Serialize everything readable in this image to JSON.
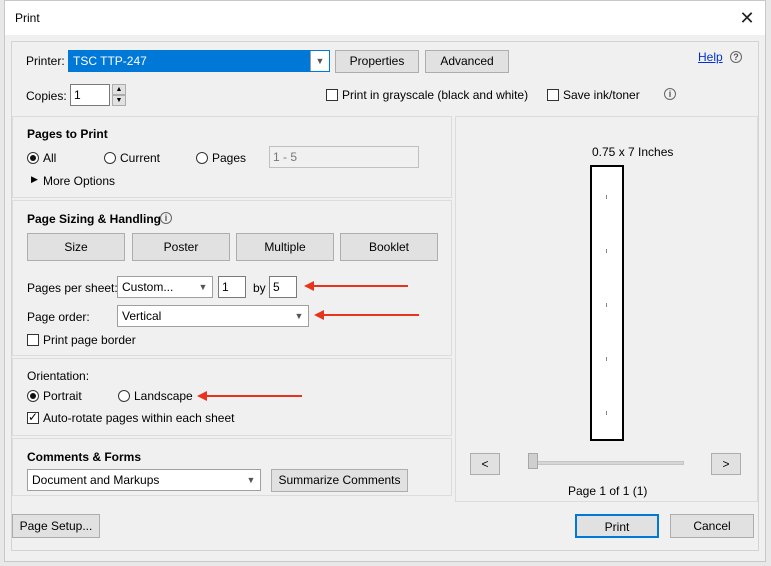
{
  "window": {
    "title": "Print",
    "close_label": "✕"
  },
  "header": {
    "printer_label": "Printer:",
    "printer_value": "TSC TTP-247",
    "properties_label": "Properties",
    "advanced_label": "Advanced",
    "help_label": "Help",
    "copies_label": "Copies:",
    "copies_value": "1",
    "grayscale_label": "Print in grayscale (black and white)",
    "save_ink_label": "Save ink/toner"
  },
  "pages_to_print": {
    "title": "Pages to Print",
    "all_label": "All",
    "current_label": "Current",
    "pages_label": "Pages",
    "pages_value": "1 - 5",
    "more_options_label": "More Options"
  },
  "sizing": {
    "title": "Page Sizing & Handling",
    "size_label": "Size",
    "poster_label": "Poster",
    "multiple_label": "Multiple",
    "booklet_label": "Booklet",
    "per_sheet_label": "Pages per sheet:",
    "per_sheet_value": "Custom...",
    "cols_value": "1",
    "by_label": "by",
    "rows_value": "5",
    "order_label": "Page order:",
    "order_value": "Vertical",
    "border_label": "Print page border"
  },
  "orientation": {
    "title": "Orientation:",
    "portrait_label": "Portrait",
    "landscape_label": "Landscape",
    "autorotate_label": "Auto-rotate pages within each sheet"
  },
  "comments": {
    "title": "Comments & Forms",
    "value": "Document and Markups",
    "summarize_label": "Summarize Comments"
  },
  "preview": {
    "size_label": "0.75 x 7 Inches",
    "prev_label": "<",
    "next_label": ">",
    "page_status": "Page 1 of 1 (1)"
  },
  "footer": {
    "page_setup_label": "Page Setup...",
    "print_label": "Print",
    "cancel_label": "Cancel"
  },
  "colors": {
    "accent": "#0078d7",
    "annotation_arrow": "#e8341c",
    "link": "#0033cc"
  }
}
